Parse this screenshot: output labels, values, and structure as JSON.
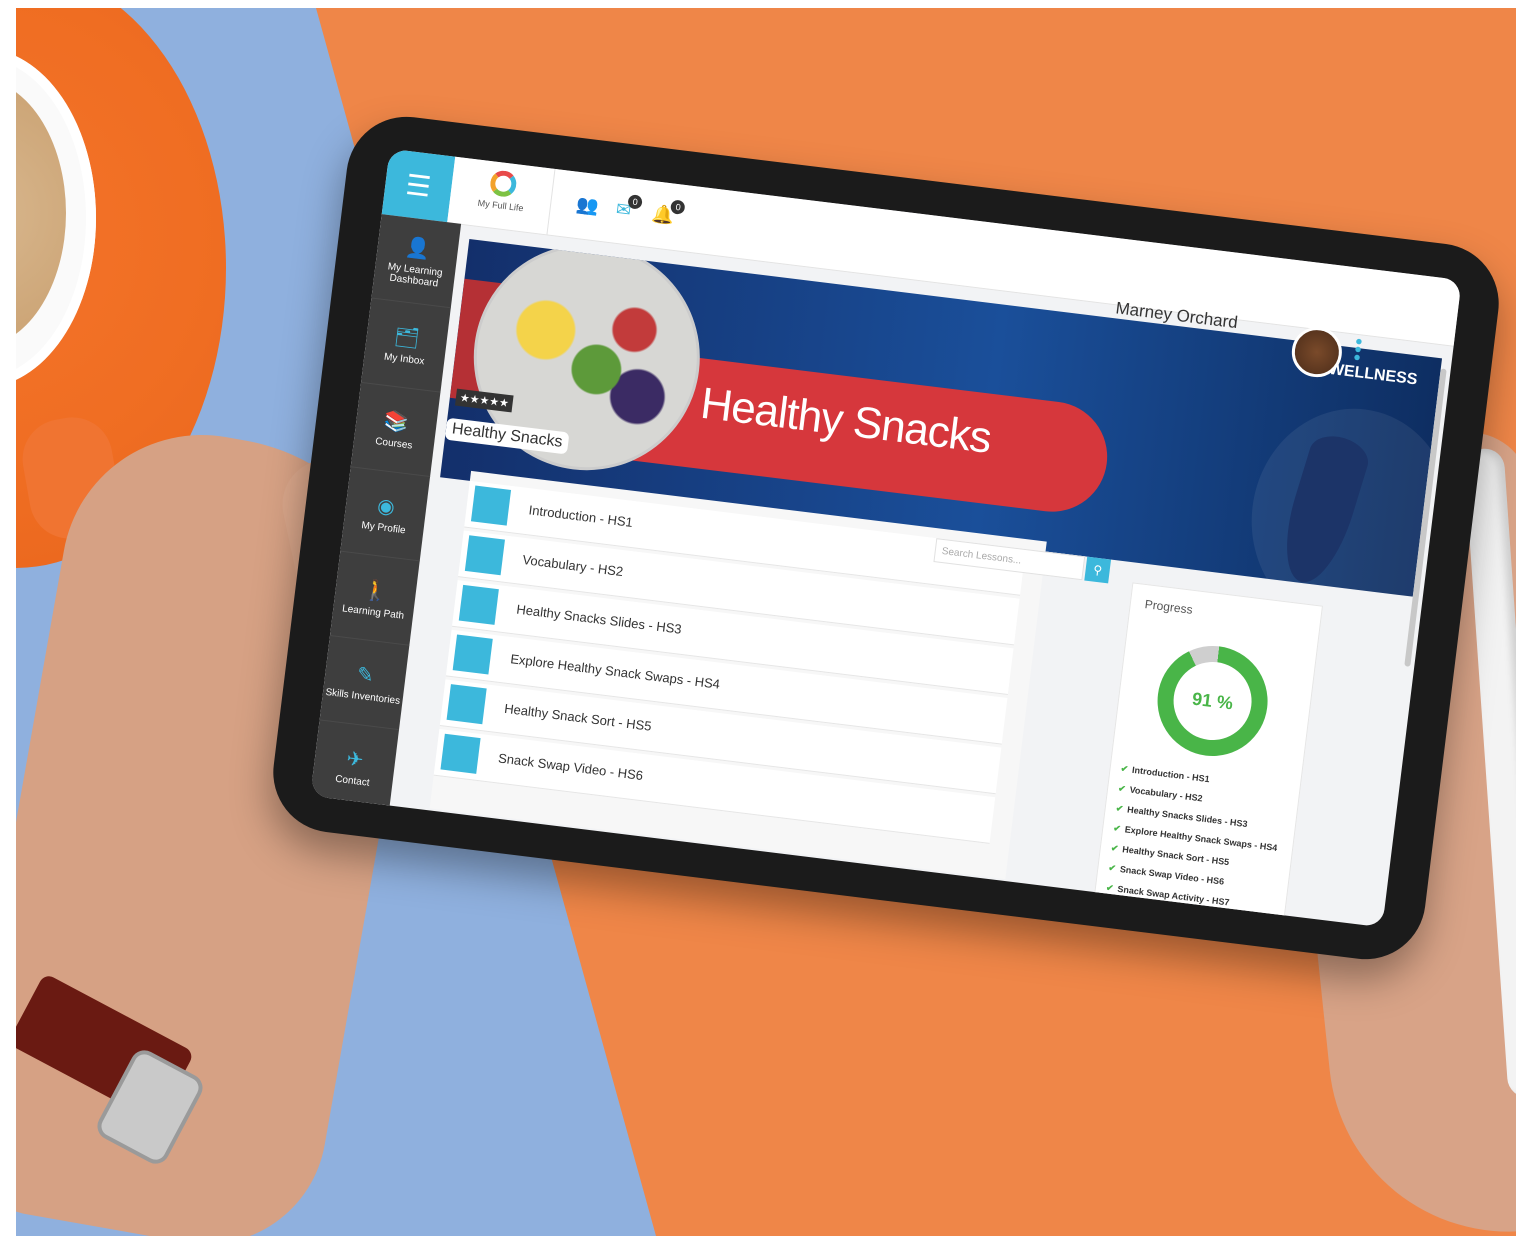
{
  "app": {
    "logo_text": "My Full Life",
    "inbox_count": "0",
    "notification_count": "0"
  },
  "sidebar": {
    "items": [
      {
        "label": "My Learning Dashboard",
        "icon": "person-icon"
      },
      {
        "label": "My Inbox",
        "icon": "inbox-icon"
      },
      {
        "label": "Courses",
        "icon": "books-icon"
      },
      {
        "label": "My Profile",
        "icon": "profile-icon"
      },
      {
        "label": "Learning Path",
        "icon": "walking-person-icon"
      },
      {
        "label": "Skills Inventories",
        "icon": "edit-icon"
      },
      {
        "label": "Contact",
        "icon": "paper-plane-icon"
      }
    ]
  },
  "banner": {
    "title": "Healthy Snacks",
    "photo_label": "Healthy Snacks",
    "stars": "★★★★★",
    "category": "WELLNESS"
  },
  "user": {
    "name": "Marney Orchard"
  },
  "search": {
    "placeholder": "Search Lessons..."
  },
  "lessons": [
    {
      "label": "Introduction - HS1"
    },
    {
      "label": "Vocabulary - HS2"
    },
    {
      "label": "Healthy Snacks Slides - HS3"
    },
    {
      "label": "Explore Healthy Snack Swaps - HS4"
    },
    {
      "label": "Healthy Snack Sort - HS5"
    },
    {
      "label": "Snack Swap Video - HS6"
    }
  ],
  "progress": {
    "title": "Progress",
    "percent_label": "91 %",
    "percent_value": 91,
    "items": [
      "Introduction - HS1",
      "Vocabulary - HS2",
      "Healthy Snacks Slides - HS3",
      "Explore Healthy Snack Swaps - HS4",
      "Healthy Snack Sort - HS5",
      "Snack Swap Video - HS6",
      "Snack Swap Activity - HS7"
    ]
  },
  "colors": {
    "accent": "#3cb8dc",
    "sidebar": "#3e3e3e",
    "banner_red": "#d6373c",
    "progress_green": "#49b548"
  }
}
